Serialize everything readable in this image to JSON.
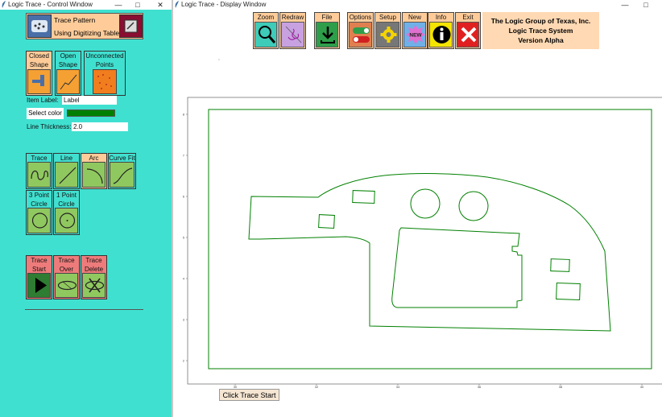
{
  "control_window": {
    "title": "Logic Trace - Control Window",
    "header": {
      "line1": "Trace Pattern",
      "line2": "Using Digitizing Tablet"
    },
    "shape_buttons": [
      {
        "label1": "Closed",
        "label2": "Shape",
        "icon": "closed-shape-icon"
      },
      {
        "label1": "Open",
        "label2": "Shape",
        "icon": "open-shape-icon"
      },
      {
        "label1": "Unconnected",
        "label2": "Points",
        "icon": "unconnected-points-icon"
      }
    ],
    "item_label": {
      "label": "Item Label:",
      "value": "Label"
    },
    "select_color": {
      "label": "Select color",
      "value": "#008000"
    },
    "line_thickness": {
      "label": "Line Thickness:",
      "value": "2.0"
    },
    "tools_row1": [
      {
        "label": "Trace",
        "icon": "trace-icon"
      },
      {
        "label": "Line",
        "icon": "line-icon"
      },
      {
        "label": "Arc",
        "icon": "arc-icon"
      },
      {
        "label": "Curve Fit",
        "icon": "curve-fit-icon"
      }
    ],
    "tools_row2": [
      {
        "label1": "3 Point",
        "label2": "Circle",
        "icon": "three-point-circle-icon"
      },
      {
        "label1": "1 Point",
        "label2": "Circle",
        "icon": "one-point-circle-icon"
      }
    ],
    "trace_actions": [
      {
        "label1": "Trace",
        "label2": "Start",
        "icon": "play-icon"
      },
      {
        "label1": "Trace",
        "label2": "Over",
        "icon": "ellipse-icon"
      },
      {
        "label1": "Trace",
        "label2": "Delete",
        "icon": "delete-ellipse-icon"
      }
    ]
  },
  "display_window": {
    "title": "Logic Trace - Display Window",
    "toolbar": [
      {
        "label": "Zoom",
        "icon": "magnifier-icon"
      },
      {
        "label": "Redraw",
        "icon": "redraw-icon"
      },
      {
        "label": "File",
        "icon": "download-icon"
      },
      {
        "label": "Options",
        "icon": "toggle-icon"
      },
      {
        "label": "Setup",
        "icon": "gear-icon"
      },
      {
        "label": "New",
        "icon": "new-badge-icon",
        "badge": "NEW"
      },
      {
        "label": "Info",
        "icon": "info-icon"
      },
      {
        "label": "Exit",
        "icon": "close-icon"
      }
    ],
    "company": {
      "line1": "The Logic Group of Texas, Inc.",
      "line2": "Logic Trace System",
      "line3": "Version Alpha"
    },
    "plot": {
      "x_ticks": [
        "30",
        "32",
        "34",
        "36",
        "38",
        "40"
      ],
      "y_ticks": [
        "2",
        "3",
        "4",
        "5",
        "6",
        "7",
        "8"
      ],
      "trace_color": "#008000"
    },
    "click_trace_start": "Click Trace Start"
  }
}
